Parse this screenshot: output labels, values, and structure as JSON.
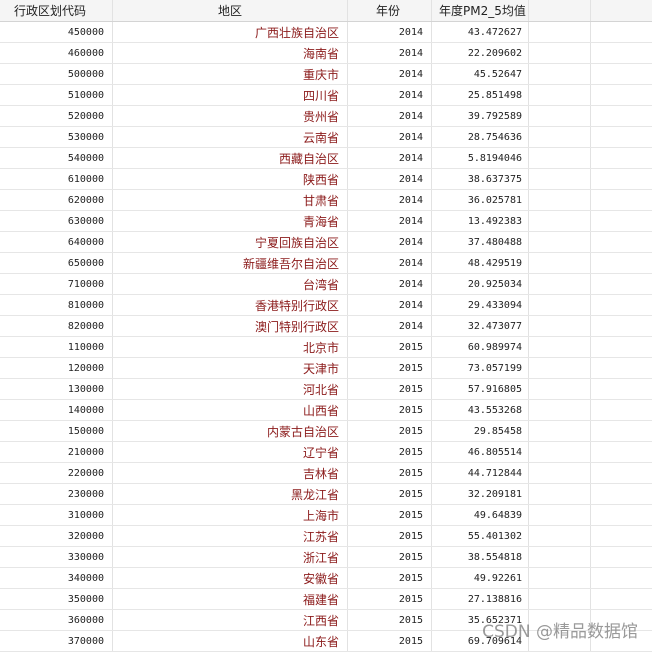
{
  "table": {
    "headers": [
      "行政区划代码",
      "地区",
      "年份",
      "年度PM2_5均值"
    ],
    "rows": [
      [
        "450000",
        "广西壮族自治区",
        "2014",
        "43.472627"
      ],
      [
        "460000",
        "海南省",
        "2014",
        "22.209602"
      ],
      [
        "500000",
        "重庆市",
        "2014",
        "45.52647"
      ],
      [
        "510000",
        "四川省",
        "2014",
        "25.851498"
      ],
      [
        "520000",
        "贵州省",
        "2014",
        "39.792589"
      ],
      [
        "530000",
        "云南省",
        "2014",
        "28.754636"
      ],
      [
        "540000",
        "西藏自治区",
        "2014",
        "5.8194046"
      ],
      [
        "610000",
        "陕西省",
        "2014",
        "38.637375"
      ],
      [
        "620000",
        "甘肃省",
        "2014",
        "36.025781"
      ],
      [
        "630000",
        "青海省",
        "2014",
        "13.492383"
      ],
      [
        "640000",
        "宁夏回族自治区",
        "2014",
        "37.480488"
      ],
      [
        "650000",
        "新疆维吾尔自治区",
        "2014",
        "48.429519"
      ],
      [
        "710000",
        "台湾省",
        "2014",
        "20.925034"
      ],
      [
        "810000",
        "香港特别行政区",
        "2014",
        "29.433094"
      ],
      [
        "820000",
        "澳门特别行政区",
        "2014",
        "32.473077"
      ],
      [
        "110000",
        "北京市",
        "2015",
        "60.989974"
      ],
      [
        "120000",
        "天津市",
        "2015",
        "73.057199"
      ],
      [
        "130000",
        "河北省",
        "2015",
        "57.916805"
      ],
      [
        "140000",
        "山西省",
        "2015",
        "43.553268"
      ],
      [
        "150000",
        "内蒙古自治区",
        "2015",
        "29.85458"
      ],
      [
        "210000",
        "辽宁省",
        "2015",
        "46.805514"
      ],
      [
        "220000",
        "吉林省",
        "2015",
        "44.712844"
      ],
      [
        "230000",
        "黑龙江省",
        "2015",
        "32.209181"
      ],
      [
        "310000",
        "上海市",
        "2015",
        "49.64839"
      ],
      [
        "320000",
        "江苏省",
        "2015",
        "55.401302"
      ],
      [
        "330000",
        "浙江省",
        "2015",
        "38.554818"
      ],
      [
        "340000",
        "安徽省",
        "2015",
        "49.92261"
      ],
      [
        "350000",
        "福建省",
        "2015",
        "27.138816"
      ],
      [
        "360000",
        "江西省",
        "2015",
        "35.652371"
      ],
      [
        "370000",
        "山东省",
        "2015",
        "69.709614"
      ]
    ]
  },
  "watermark": "CSDN @精品数据馆"
}
